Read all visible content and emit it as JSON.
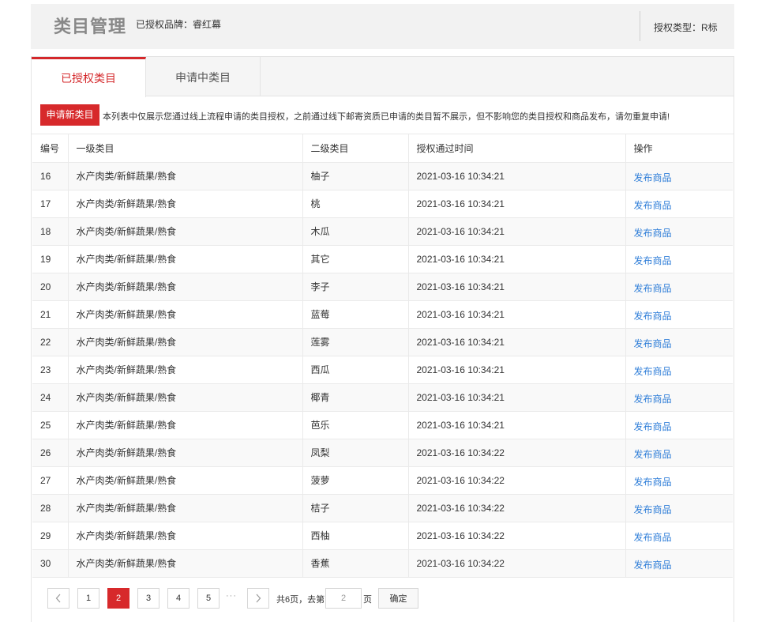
{
  "header": {
    "title": "类目管理",
    "brand": "已授权品牌：睿红幕",
    "auth_type": "授权类型：R标"
  },
  "tabs": [
    {
      "label": "已授权类目",
      "active": true
    },
    {
      "label": "申请中类目",
      "active": false
    }
  ],
  "apply_button": "申请新类目",
  "notice": "本列表中仅展示您通过线上流程申请的类目授权，之前通过线下邮寄资质已申请的类目暂不展示，但不影响您的类目授权和商品发布，请勿重复申请!",
  "table": {
    "columns": [
      "编号",
      "一级类目",
      "二级类目",
      "授权通过时间",
      "操作"
    ],
    "action_label": "发布商品",
    "rows": [
      {
        "id": "16",
        "level1": "水产肉类/新鲜蔬果/熟食",
        "level2": "柚子",
        "time": "2021-03-16 10:34:21"
      },
      {
        "id": "17",
        "level1": "水产肉类/新鲜蔬果/熟食",
        "level2": "桃",
        "time": "2021-03-16 10:34:21"
      },
      {
        "id": "18",
        "level1": "水产肉类/新鲜蔬果/熟食",
        "level2": "木瓜",
        "time": "2021-03-16 10:34:21"
      },
      {
        "id": "19",
        "level1": "水产肉类/新鲜蔬果/熟食",
        "level2": "其它",
        "time": "2021-03-16 10:34:21"
      },
      {
        "id": "20",
        "level1": "水产肉类/新鲜蔬果/熟食",
        "level2": "李子",
        "time": "2021-03-16 10:34:21"
      },
      {
        "id": "21",
        "level1": "水产肉类/新鲜蔬果/熟食",
        "level2": "蓝莓",
        "time": "2021-03-16 10:34:21"
      },
      {
        "id": "22",
        "level1": "水产肉类/新鲜蔬果/熟食",
        "level2": "莲雾",
        "time": "2021-03-16 10:34:21"
      },
      {
        "id": "23",
        "level1": "水产肉类/新鲜蔬果/熟食",
        "level2": "西瓜",
        "time": "2021-03-16 10:34:21"
      },
      {
        "id": "24",
        "level1": "水产肉类/新鲜蔬果/熟食",
        "level2": "椰青",
        "time": "2021-03-16 10:34:21"
      },
      {
        "id": "25",
        "level1": "水产肉类/新鲜蔬果/熟食",
        "level2": "芭乐",
        "time": "2021-03-16 10:34:21"
      },
      {
        "id": "26",
        "level1": "水产肉类/新鲜蔬果/熟食",
        "level2": "凤梨",
        "time": "2021-03-16 10:34:22"
      },
      {
        "id": "27",
        "level1": "水产肉类/新鲜蔬果/熟食",
        "level2": "菠萝",
        "time": "2021-03-16 10:34:22"
      },
      {
        "id": "28",
        "level1": "水产肉类/新鲜蔬果/熟食",
        "level2": "桔子",
        "time": "2021-03-16 10:34:22"
      },
      {
        "id": "29",
        "level1": "水产肉类/新鲜蔬果/熟食",
        "level2": "西柚",
        "time": "2021-03-16 10:34:22"
      },
      {
        "id": "30",
        "level1": "水产肉类/新鲜蔬果/熟食",
        "level2": "香蕉",
        "time": "2021-03-16 10:34:22"
      }
    ]
  },
  "pagination": {
    "pages": [
      "1",
      "2",
      "3",
      "4",
      "5"
    ],
    "current": "2",
    "ellipsis": "···",
    "total": "共6页，去第",
    "input_value": "2",
    "unit": "页",
    "confirm": "确定"
  }
}
